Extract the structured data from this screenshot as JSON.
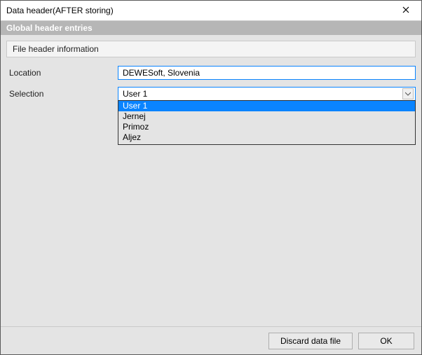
{
  "window": {
    "title": "Data header(AFTER storing)"
  },
  "subheader": {
    "label": "Global header entries"
  },
  "section": {
    "label": "File header information"
  },
  "form": {
    "location_label": "Location",
    "location_value": "DEWESoft, Slovenia",
    "selection_label": "Selection",
    "selection_value": "User 1",
    "selection_options": [
      {
        "label": "User 1",
        "selected": true
      },
      {
        "label": "Jernej",
        "selected": false
      },
      {
        "label": "Primoz",
        "selected": false
      },
      {
        "label": "Aljez",
        "selected": false
      }
    ]
  },
  "footer": {
    "discard_label": "Discard data file",
    "ok_label": "OK"
  }
}
